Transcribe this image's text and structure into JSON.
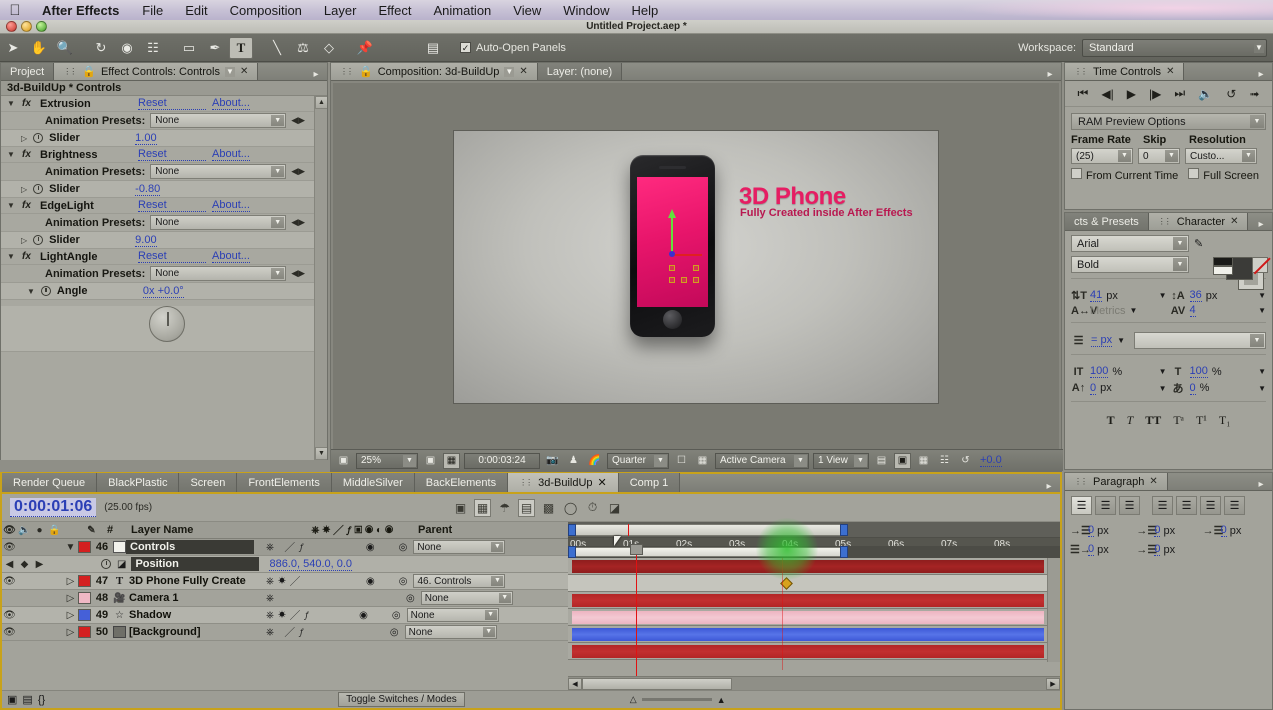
{
  "os": {
    "apple_icon": "apple-icon",
    "app_name": "After Effects",
    "menus": [
      "File",
      "Edit",
      "Composition",
      "Layer",
      "Effect",
      "Animation",
      "View",
      "Window",
      "Help"
    ]
  },
  "window": {
    "title": "Untitled Project.aep *"
  },
  "toolbar": {
    "tools": [
      "selection-tool",
      "hand-tool",
      "zoom-tool",
      "rotate-tool",
      "orbit-camera-tool",
      "pan-behind-tool",
      "shape-tool",
      "pen-tool",
      "text-tool",
      "brush-tool",
      "clone-stamp-tool",
      "eraser-tool",
      "puppet-pin-tool"
    ],
    "auto_open_label": "Auto-Open Panels",
    "auto_open_checked": "✓",
    "workspace_label": "Workspace:",
    "workspace_value": "Standard"
  },
  "effect_controls": {
    "tabs": [
      {
        "label": "Project",
        "active": false
      },
      {
        "label": "Effect Controls: Controls",
        "active": true
      }
    ],
    "subtitle": "3d-BuildUp * Controls",
    "reset_label": "Reset",
    "about_label": "About...",
    "presets_label": "Animation Presets:",
    "presets_value": "None",
    "effects": [
      {
        "name": "Extrusion",
        "param": "Slider",
        "value": "1.00"
      },
      {
        "name": "Brightness",
        "param": "Slider",
        "value": "-0.80"
      },
      {
        "name": "EdgeLight",
        "param": "Slider",
        "value": "9.00"
      },
      {
        "name": "LightAngle",
        "param": "Angle",
        "value": "0x +0.0°"
      }
    ]
  },
  "composition": {
    "tabs": [
      {
        "label": "Composition: 3d-BuildUp",
        "active": true
      },
      {
        "label": "Layer: (none)",
        "active": false
      }
    ],
    "canvas": {
      "title": "3D Phone",
      "subtitle": "Fully Created inside After Effects"
    },
    "footer": {
      "zoom": "25%",
      "timecode": "0:00:03:24",
      "quality": "Quarter",
      "camera": "Active Camera",
      "views": "1 View",
      "exposure": "+0.0",
      "icons": [
        "always-preview-icon",
        "region-of-interest-icon",
        "take-snapshot-icon",
        "show-snapshot-icon",
        "show-channel-icon",
        "transparency-grid-icon",
        "toggle-mask-icon",
        "title-safe-icon",
        "timeline-icon",
        "comp-flowchart-icon",
        "reset-exposure-icon"
      ]
    }
  },
  "time_controls": {
    "tab_label": "Time Controls",
    "transport": [
      "first-frame-icon",
      "previous-frame-icon",
      "play-icon",
      "next-frame-icon",
      "last-frame-icon",
      "audio-icon",
      "loop-icon",
      "ram-preview-icon"
    ],
    "ram_preview_label": "RAM Preview Options",
    "frame_rate_label": "Frame Rate",
    "frame_rate_value": "(25)",
    "skip_label": "Skip",
    "skip_value": "0",
    "resolution_label": "Resolution",
    "resolution_value": "Custo...",
    "from_current_time_label": "From Current Time",
    "full_screen_label": "Full Screen"
  },
  "character": {
    "tabs": [
      {
        "label": "cts & Presets",
        "active": false
      },
      {
        "label": "Character",
        "active": true
      }
    ],
    "font_family": "Arial",
    "font_style": "Bold",
    "font_size": "41",
    "leading": "36",
    "kerning": "Metrics",
    "tracking": "4",
    "baseline_px": "= px",
    "vertical_scale": "100",
    "horizontal_scale": "100",
    "baseline_shift": "0",
    "tsume": "0",
    "unit_px": "px",
    "unit_pct": "%",
    "styles": [
      "bold-style",
      "italic-style",
      "all-caps-style",
      "small-caps-style",
      "superscript-style",
      "subscript-style"
    ]
  },
  "paragraph": {
    "tab_label": "Paragraph",
    "align_buttons": [
      "align-left-icon",
      "align-center-icon",
      "align-right-icon",
      "justify-last-left-icon",
      "justify-last-center-icon",
      "justify-last-right-icon",
      "justify-all-icon"
    ],
    "fields": [
      {
        "icon": "indent-left-icon",
        "value": "0",
        "unit": "px"
      },
      {
        "icon": "indent-first-line-icon",
        "value": "0",
        "unit": "px"
      },
      {
        "icon": "indent-right-icon",
        "value": "0",
        "unit": "px"
      },
      {
        "icon": "space-before-icon",
        "value": "0",
        "unit": "px"
      },
      {
        "icon": "space-after-icon",
        "value": "0",
        "unit": "px"
      }
    ]
  },
  "timeline": {
    "tabs": [
      {
        "label": "Render Queue",
        "active": false
      },
      {
        "label": "BlackPlastic",
        "active": false
      },
      {
        "label": "Screen",
        "active": false
      },
      {
        "label": "FrontElements",
        "active": false
      },
      {
        "label": "MiddleSilver",
        "active": false
      },
      {
        "label": "BackElements",
        "active": false
      },
      {
        "label": "3d-BuildUp",
        "active": true
      },
      {
        "label": "Comp 1",
        "active": false
      }
    ],
    "current_time": "0:00:01:06",
    "fps": "(25.00 fps)",
    "columns": {
      "hash": "#",
      "layer_name": "Layer Name",
      "parent": "Parent"
    },
    "ruler_labels": [
      "00s",
      "01s",
      "02s",
      "03s",
      "04s",
      "05s",
      "06s",
      "07s",
      "08s"
    ],
    "layers": [
      {
        "num": "46",
        "name": "Controls",
        "parent": "None",
        "color": "#d42020",
        "type": "solid-layer",
        "selected": true
      },
      {
        "num": "47",
        "name": "3D Phone Fully Create",
        "parent": "46. Controls",
        "color": "#d42020",
        "type": "text-layer",
        "selected": false
      },
      {
        "num": "48",
        "name": "Camera 1",
        "parent": "None",
        "color": "#f0b8c4",
        "type": "camera-layer",
        "selected": false
      },
      {
        "num": "49",
        "name": "Shadow",
        "parent": "None",
        "color": "#4560d8",
        "type": "shape-layer",
        "selected": false
      },
      {
        "num": "50",
        "name": "[Background]",
        "parent": "None",
        "color": "#d42020",
        "type": "solid-layer",
        "selected": false
      }
    ],
    "property_row": {
      "name": "Position",
      "value": "886.0, 540.0, 0.0"
    },
    "footer_label": "Toggle Switches / Modes"
  }
}
